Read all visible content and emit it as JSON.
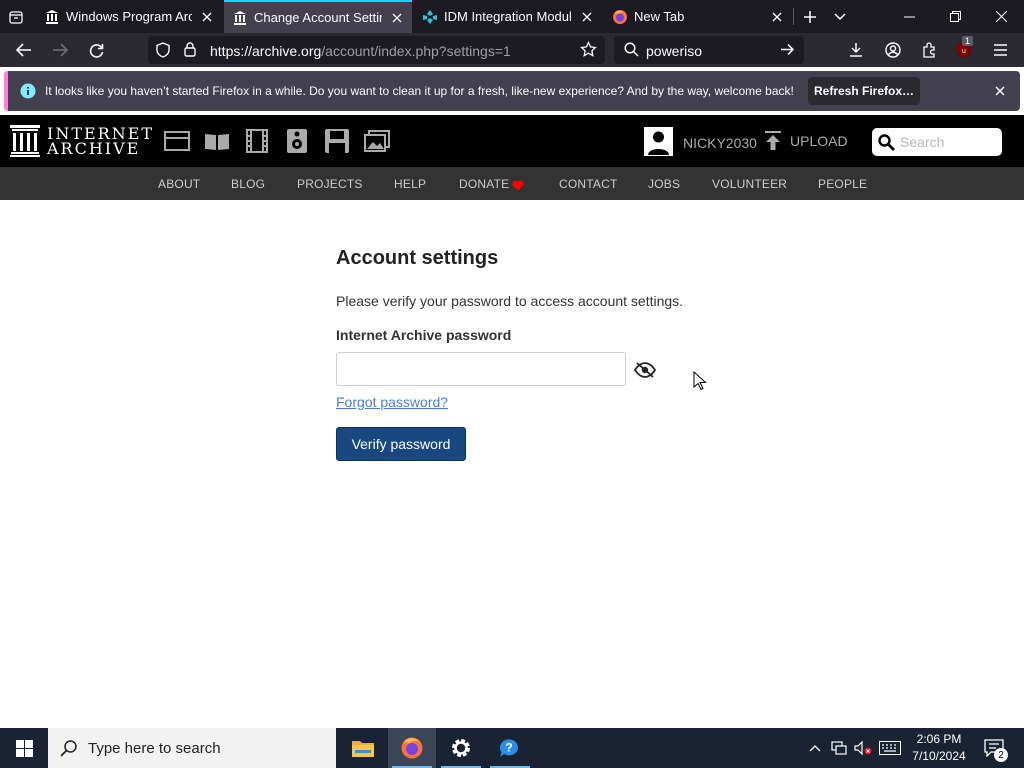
{
  "browser": {
    "tabs": [
      {
        "title": "Windows Program Archi",
        "active": false
      },
      {
        "title": "Change Account Settings",
        "active": true
      },
      {
        "title": "IDM Integration Module",
        "active": false
      },
      {
        "title": "New Tab",
        "active": false
      }
    ],
    "url_host": "https://archive.org",
    "url_rest": "/account/index.php?settings=1",
    "search_value": "poweriso",
    "extension_badge": "1"
  },
  "notification": {
    "message": "It looks like you haven’t started Firefox in a while. Do you want to clean it up for a fresh, like-new experience? And by the way, welcome back!",
    "button_label": "Refresh Firefox…"
  },
  "ia_header": {
    "logo_line1": "INTERNET",
    "logo_line2": "ARCHIVE",
    "username": "NICKY2030",
    "upload_label": "UPLOAD",
    "search_placeholder": "Search",
    "nav": [
      "ABOUT",
      "BLOG",
      "PROJECTS",
      "HELP",
      "DONATE",
      "CONTACT",
      "JOBS",
      "VOLUNTEER",
      "PEOPLE"
    ]
  },
  "content": {
    "heading": "Account settings",
    "lead": "Please verify your password to access account settings.",
    "password_label": "Internet Archive password",
    "password_value": "",
    "forgot_link": "Forgot password?",
    "verify_button": "Verify password"
  },
  "taskbar": {
    "search_placeholder": "Type here to search",
    "time": "2:06 PM",
    "date": "7/10/2024",
    "notification_count": "2"
  },
  "colors": {
    "ff_tabstrip": "#1c1b22",
    "ff_toolbar": "#2b2a33",
    "ff_accent": "#00ddff",
    "notif_accent": "#ff7fdc",
    "ia_header_bg": "#000000",
    "ia_nav_bg": "#333333",
    "verify_button": "#194880",
    "link": "#4a7ed2",
    "taskbar_bg": "#1a2333"
  },
  "icons": {
    "browser": [
      "tab-list-icon",
      "archive-favicon",
      "idm-favicon",
      "firefox-favicon",
      "close-icon",
      "new-tab-icon",
      "tab-overflow-chevron-icon",
      "minimize-icon",
      "restore-icon",
      "window-close-icon",
      "back-icon",
      "forward-icon",
      "reload-icon",
      "tracking-shield-icon",
      "lock-icon",
      "bookmark-star-icon",
      "search-icon",
      "go-arrow-icon",
      "downloads-icon",
      "account-icon",
      "extensions-icon",
      "ublock-icon",
      "menu-icon"
    ],
    "ia_media": [
      "web-icon",
      "texts-icon",
      "video-icon",
      "audio-icon",
      "software-icon",
      "images-icon"
    ],
    "page": [
      "show-password-eye-icon"
    ],
    "taskbar": [
      "windows-start-icon",
      "file-explorer-icon",
      "firefox-icon",
      "settings-gear-icon",
      "help-icon",
      "chevron-up-icon",
      "network-icon",
      "volume-muted-icon",
      "keyboard-icon",
      "action-center-icon"
    ]
  }
}
